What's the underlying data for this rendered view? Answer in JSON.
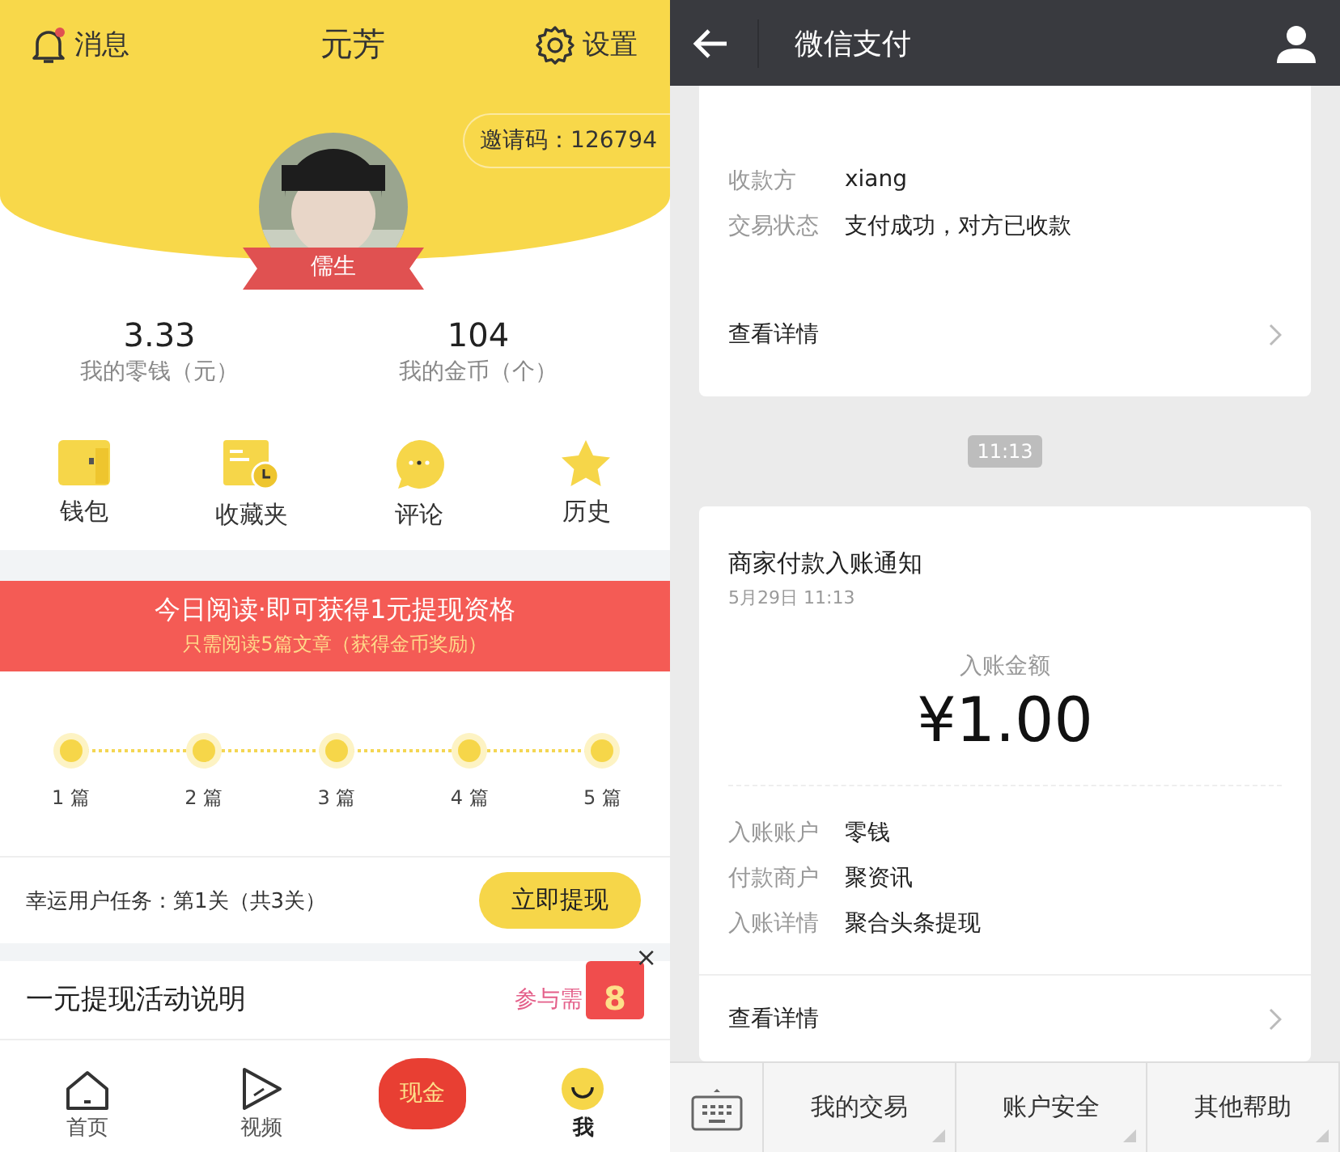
{
  "profile_screen": {
    "header": {
      "messages_label": "消息",
      "title": "元芳",
      "settings_label": "设置",
      "has_unread": true,
      "invite_code": "邀请码：126794",
      "rank_ribbon": "儒生"
    },
    "stats": [
      {
        "value": "3.33",
        "label": "我的零钱（元）"
      },
      {
        "value": "104",
        "label": "我的金币（个）"
      }
    ],
    "shortcuts": [
      {
        "kind": "wallet",
        "label": "钱包"
      },
      {
        "kind": "favorites",
        "label": "收藏夹"
      },
      {
        "kind": "comment",
        "label": "评论"
      },
      {
        "kind": "history",
        "label": "历史"
      }
    ],
    "banner": {
      "title": "今日阅读·即可获得1元提现资格",
      "subtitle": "只需阅读5篇文章（获得金币奖励）"
    },
    "progress_steps": [
      "1 篇",
      "2 篇",
      "3 篇",
      "4 篇",
      "5 篇"
    ],
    "task": {
      "text": "幸运用户任务：第1关（共3关）",
      "button": "立即提现"
    },
    "activity": {
      "title": "一元提现活动说明",
      "link": "参与需",
      "badge_number": "8",
      "close": "×"
    },
    "tab_bar": [
      {
        "kind": "home",
        "label": "首页",
        "selected": false
      },
      {
        "kind": "video",
        "label": "视频",
        "selected": false
      },
      {
        "kind": "cash",
        "label": "现金",
        "selected": false
      },
      {
        "kind": "me",
        "label": "我",
        "selected": true
      }
    ]
  },
  "wechat_pay_screen": {
    "title": "微信支付",
    "payment_card": {
      "rows": [
        {
          "label": "收款方",
          "value": "xiang"
        },
        {
          "label": "交易状态",
          "value": "支付成功，对方已收款"
        }
      ],
      "details_link": "查看详情"
    },
    "time_chip": "11:13",
    "notice_card": {
      "title": "商家付款入账通知",
      "date": "5月29日  11:13",
      "amount_label": "入账金额",
      "amount": "¥1.00",
      "rows": [
        {
          "label": "入账账户",
          "value": "零钱"
        },
        {
          "label": "付款商户",
          "value": "聚资讯"
        },
        {
          "label": "入账详情",
          "value": "聚合头条提现"
        }
      ],
      "details_link": "查看详情"
    },
    "bottom_menu": [
      "我的交易",
      "账户安全",
      "其他帮助"
    ]
  }
}
